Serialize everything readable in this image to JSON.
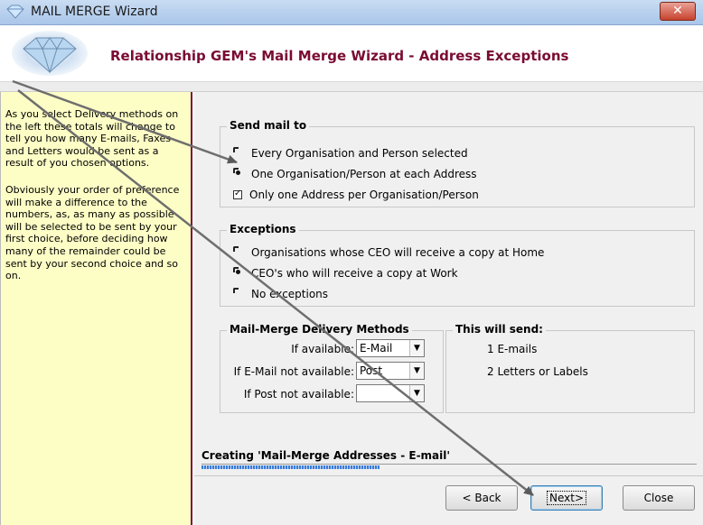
{
  "window": {
    "title": "MAIL MERGE Wizard",
    "close_label": "✕",
    "app_icon": "gem-icon"
  },
  "header": {
    "title": "Relationship GEM's Mail Merge Wizard - Address Exceptions",
    "logo": "diamond-gem-logo"
  },
  "left_panel": {
    "para1": "As you select Delivery methods on the left these totals will change to tell you how many E-mails, Faxes and Letters would be sent as a result of you chosen options.",
    "para2": "Obviously your order of preference will make a difference to the numbers, as, as many as possible will be selected to be sent by your first choice, before deciding how many of the remainder could be sent by your second choice and so on."
  },
  "send_mail_to": {
    "title": "Send mail to",
    "options": [
      {
        "label": "Every Organisation and Person selected",
        "checked": false
      },
      {
        "label": "One Organisation/Person at each Address",
        "checked": true
      }
    ],
    "checkbox": {
      "label": "Only one Address per Organisation/Person",
      "checked": true
    }
  },
  "exceptions": {
    "title": "Exceptions",
    "options": [
      {
        "label": "Organisations whose CEO will receive a copy at Home",
        "checked": false
      },
      {
        "label": "CEO's who will receive a copy at Work",
        "checked": true
      },
      {
        "label": "No exceptions",
        "checked": false
      }
    ]
  },
  "delivery": {
    "title": "Mail-Merge Delivery Methods",
    "rows": [
      {
        "label": "If available:",
        "value": "E-Mail"
      },
      {
        "label": "If E-Mail not available:",
        "value": "Post"
      },
      {
        "label": "If Post not available:",
        "value": ""
      }
    ],
    "dropdown_icon": "chevron-down-icon"
  },
  "will_send": {
    "title": "This will send:",
    "lines": [
      "1 E-mails",
      "2 Letters or Labels"
    ]
  },
  "progress": {
    "label": "Creating 'Mail-Merge Addresses - E-mail'",
    "fraction": 0.36
  },
  "buttons": {
    "back": "< Back",
    "next": "Next>",
    "close": "Close"
  },
  "colors": {
    "header_title": "#7a0b33",
    "left_panel_bg": "#fdfdc6",
    "accent_border": "#7a0b33",
    "progress": "#3b7bd8"
  }
}
